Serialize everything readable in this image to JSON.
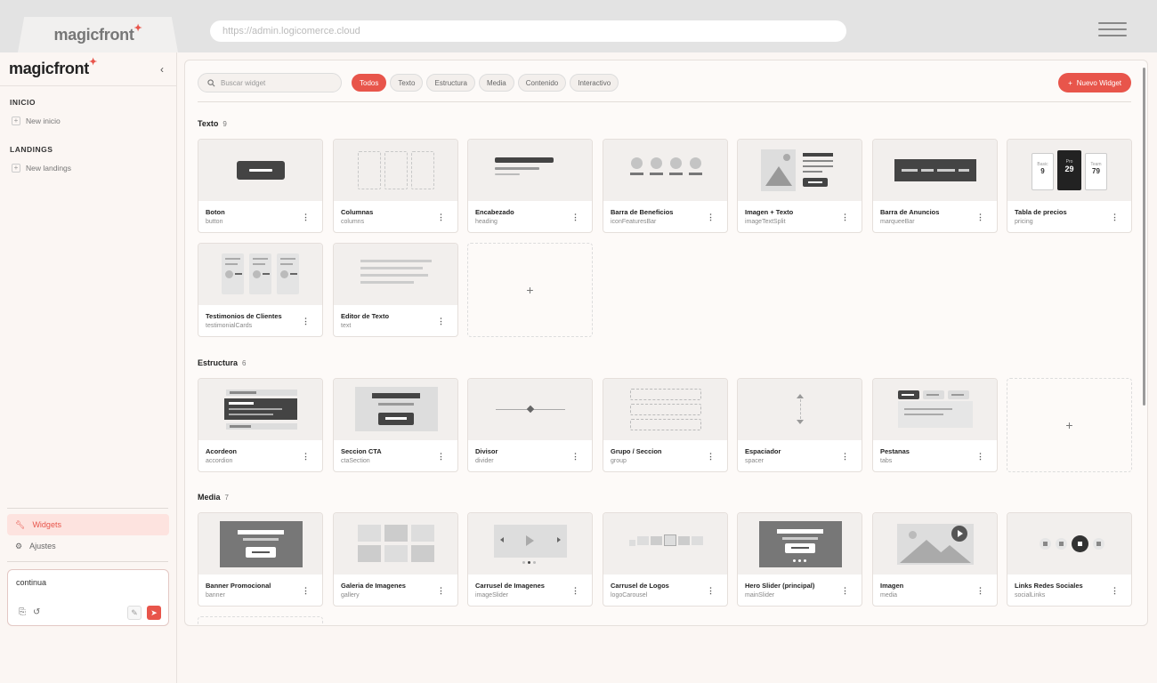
{
  "browser": {
    "tab_logo": "magicfront",
    "url": "https://admin.logicomerce.cloud"
  },
  "sidebar": {
    "logo": "magicfront",
    "collapse_icon": "chevron-left-icon",
    "sections": [
      {
        "title": "INICIO",
        "item": "New inicio"
      },
      {
        "title": "LANDINGS",
        "item": "New landings"
      }
    ],
    "nav": [
      {
        "label": "Widgets",
        "icon": "wrench-icon",
        "active": true
      },
      {
        "label": "Ajustes",
        "icon": "gear-icon",
        "active": false
      }
    ],
    "chat": {
      "value": "continua"
    }
  },
  "toolbar": {
    "search_placeholder": "Buscar widget",
    "filters": [
      "Todos",
      "Texto",
      "Estructura",
      "Media",
      "Contenido",
      "Interactivo"
    ],
    "active_filter": "Todos",
    "new_button": "Nuevo Widget"
  },
  "sections": [
    {
      "title": "Texto",
      "count": "9",
      "cards": [
        {
          "name": "Boton",
          "id": "button"
        },
        {
          "name": "Columnas",
          "id": "columns"
        },
        {
          "name": "Encabezado",
          "id": "heading"
        },
        {
          "name": "Barra de Beneficios",
          "id": "iconFeaturesBar"
        },
        {
          "name": "Imagen + Texto",
          "id": "imageTextSplit"
        },
        {
          "name": "Barra de Anuncios",
          "id": "marqueeBar"
        },
        {
          "name": "Tabla de precios",
          "id": "pricing"
        },
        {
          "name": "Testimonios de Clientes",
          "id": "testimonialCards"
        },
        {
          "name": "Editor de Texto",
          "id": "text"
        }
      ]
    },
    {
      "title": "Estructura",
      "count": "6",
      "cards": [
        {
          "name": "Acordeon",
          "id": "accordion"
        },
        {
          "name": "Seccion CTA",
          "id": "ctaSection"
        },
        {
          "name": "Divisor",
          "id": "divider"
        },
        {
          "name": "Grupo / Seccion",
          "id": "group"
        },
        {
          "name": "Espaciador",
          "id": "spacer"
        },
        {
          "name": "Pestanas",
          "id": "tabs"
        }
      ]
    },
    {
      "title": "Media",
      "count": "7",
      "cards": [
        {
          "name": "Banner Promocional",
          "id": "banner"
        },
        {
          "name": "Galeria de Imagenes",
          "id": "gallery"
        },
        {
          "name": "Carrusel de Imagenes",
          "id": "imageSlider"
        },
        {
          "name": "Carrusel de Logos",
          "id": "logoCarousel"
        },
        {
          "name": "Hero Slider (principal)",
          "id": "mainSlider"
        },
        {
          "name": "Imagen",
          "id": "media"
        },
        {
          "name": "Links Redes Sociales",
          "id": "socialLinks"
        }
      ]
    }
  ],
  "pricing_preview": {
    "plans": [
      {
        "label": "Basic",
        "value": "9"
      },
      {
        "label": "Pro",
        "value": "29"
      },
      {
        "label": "Team",
        "value": "79"
      }
    ]
  },
  "colors": {
    "accent": "#e8554b",
    "panel": "#fdfaf8",
    "preview": "#f2efed"
  }
}
